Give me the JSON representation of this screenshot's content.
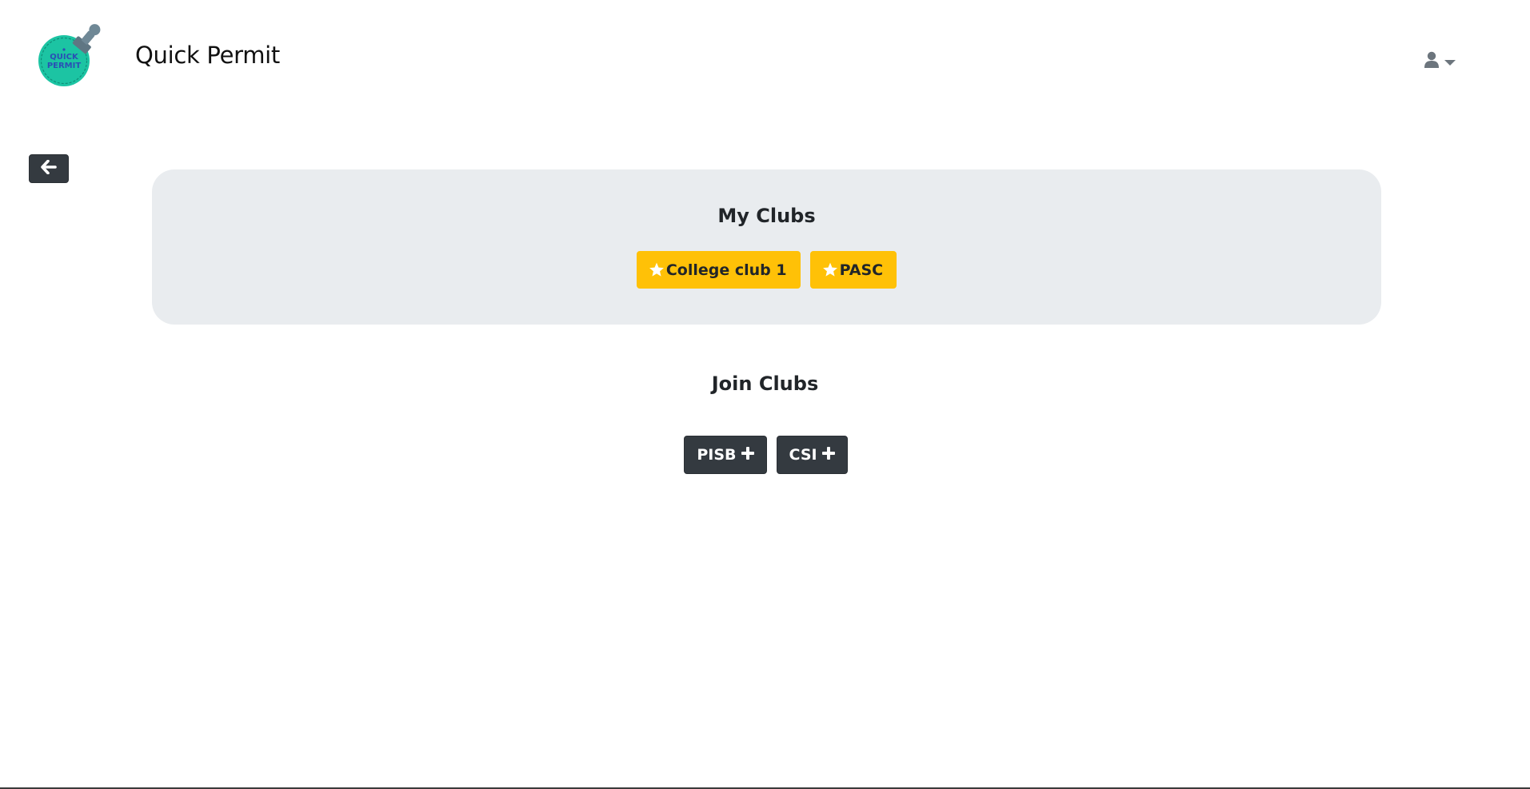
{
  "header": {
    "brand_title": "Quick Permit",
    "logo_text_line1": "QUICK",
    "logo_text_line2": "PERMIT",
    "user_icon": "user-icon",
    "dropdown_icon": "caret-down-icon"
  },
  "back_button": {
    "icon": "arrow-left-icon"
  },
  "my_clubs": {
    "title": "My Clubs",
    "items": [
      {
        "label": "College club 1",
        "icon": "star-icon"
      },
      {
        "label": "PASC",
        "icon": "star-icon"
      }
    ]
  },
  "join_clubs": {
    "title": "Join Clubs",
    "items": [
      {
        "label": "PISB",
        "icon": "plus-icon"
      },
      {
        "label": "CSI",
        "icon": "plus-icon"
      }
    ]
  },
  "colors": {
    "warning": "#ffc107",
    "dark": "#343a40",
    "panel": "#e9ecef",
    "logo_teal": "#1cc4a3",
    "logo_text": "#2a4fb5"
  }
}
